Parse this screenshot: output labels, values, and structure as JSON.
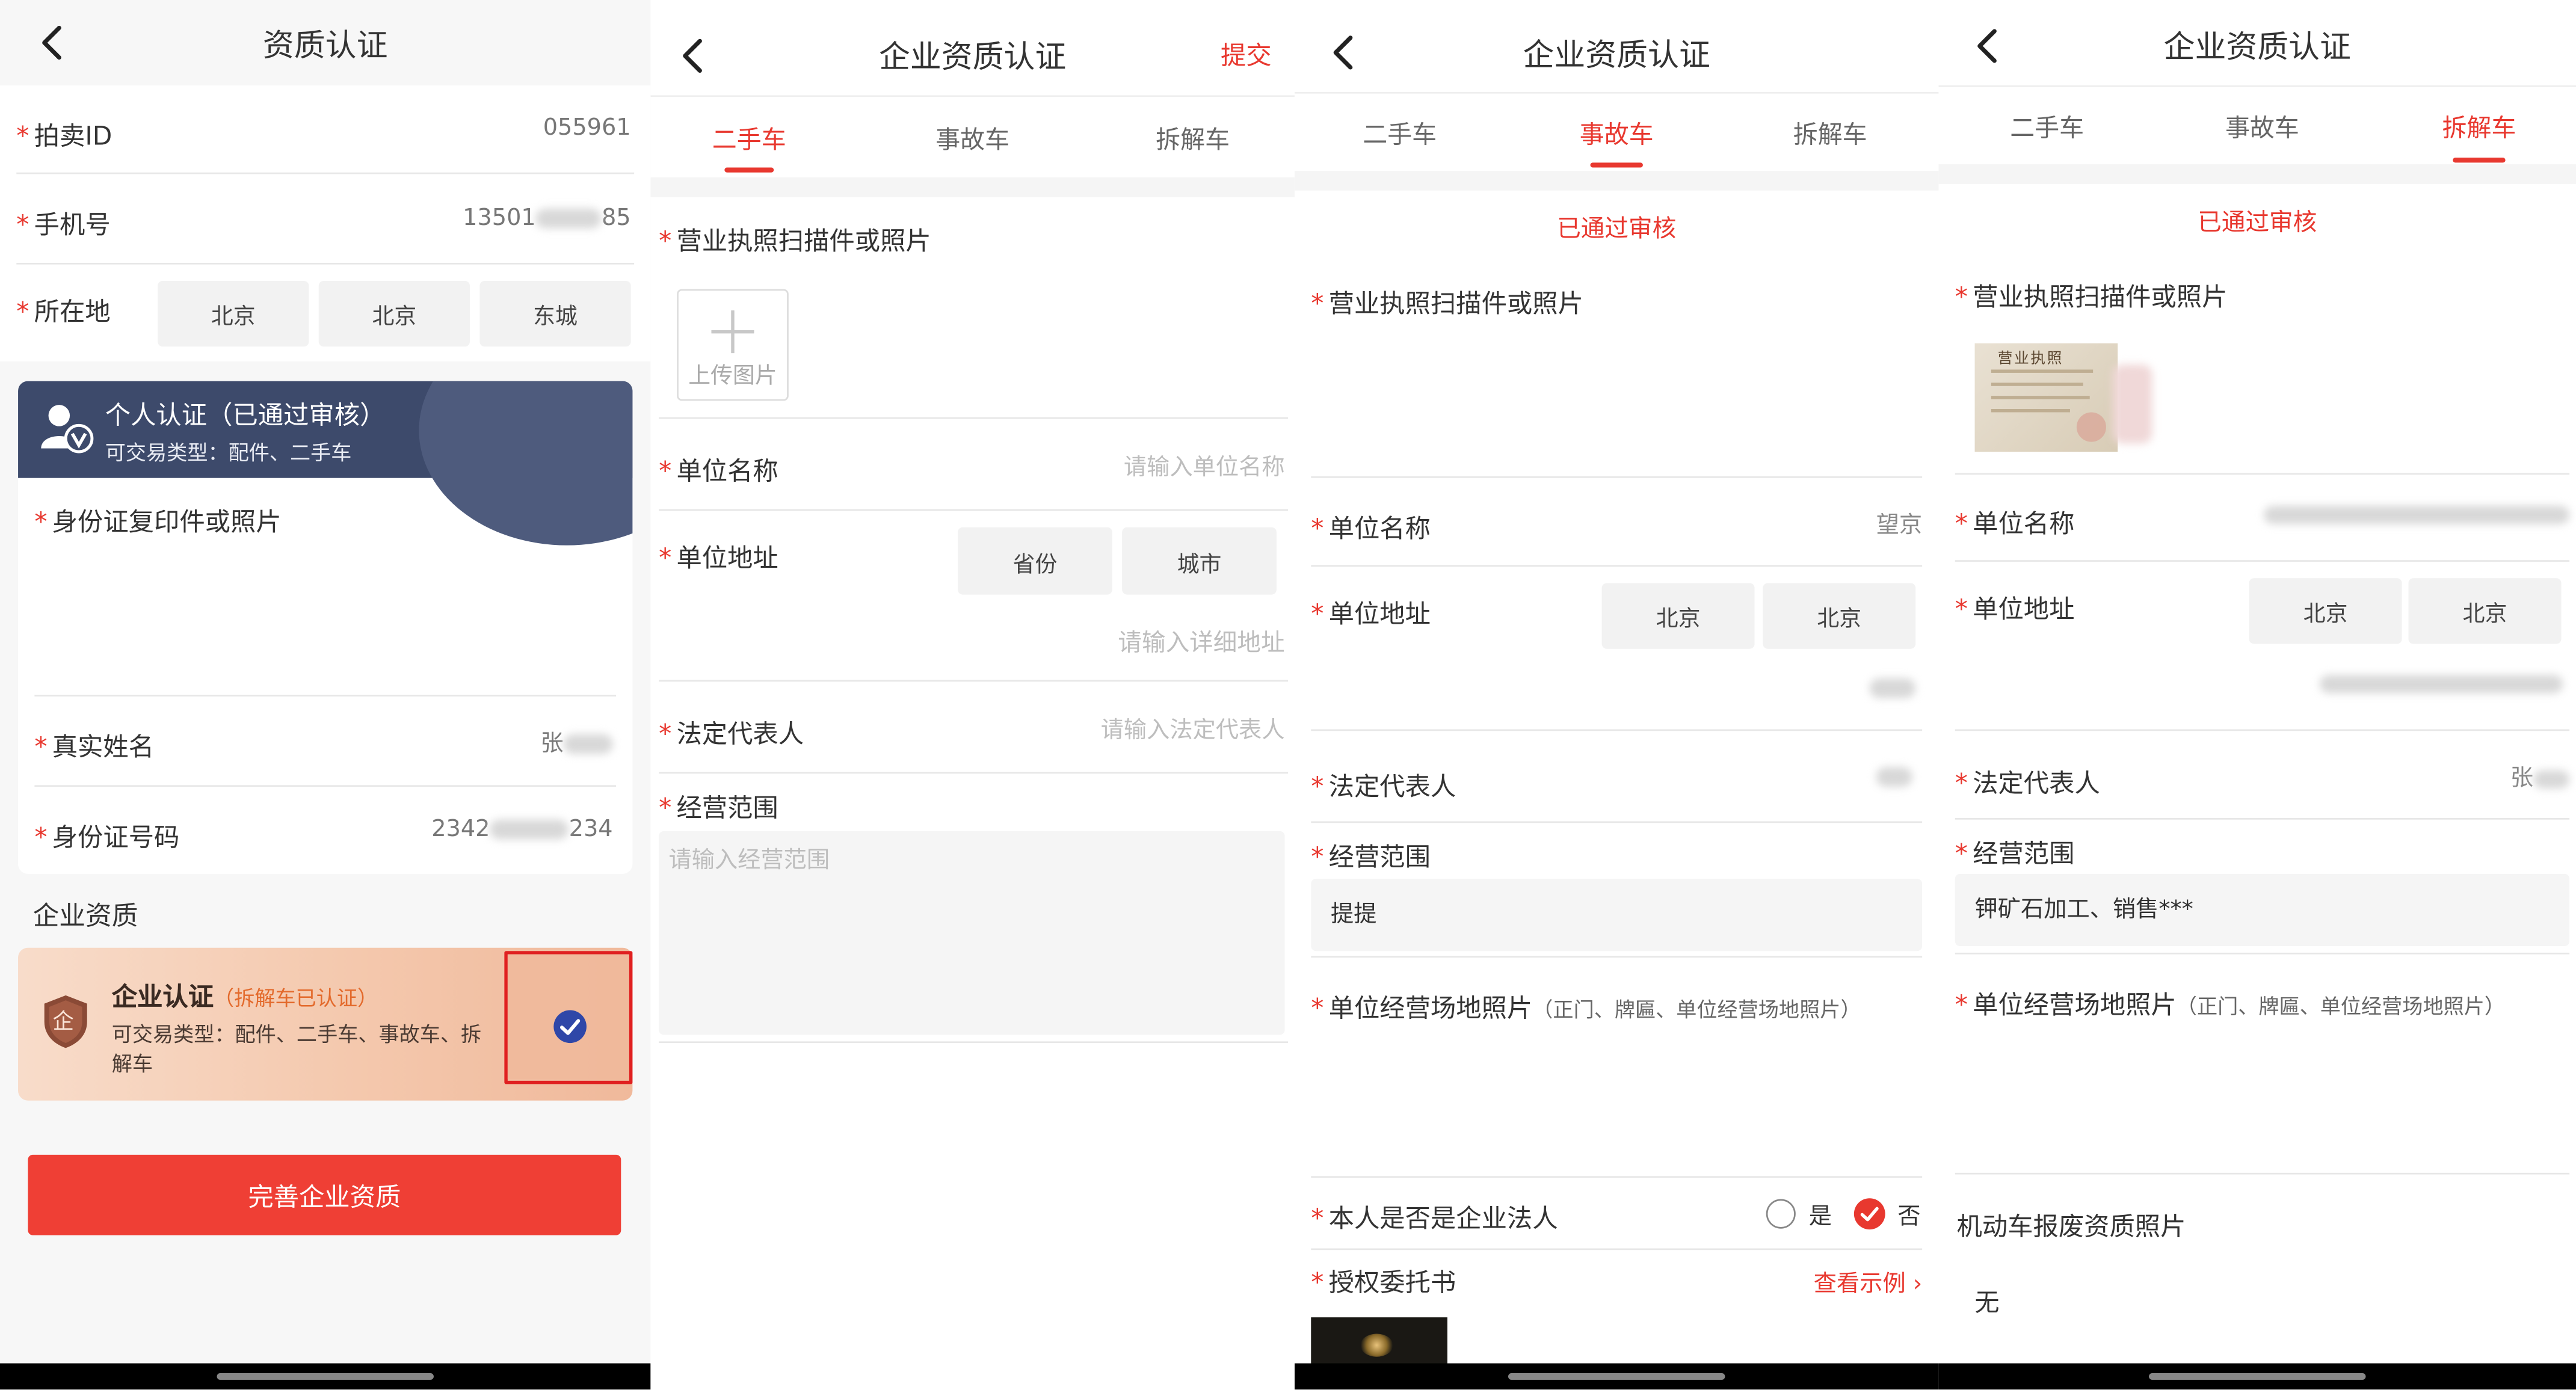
{
  "screen1": {
    "title": "资质认证",
    "required_star": "*",
    "auction_id_label": "拍卖ID",
    "auction_id_value": "055961",
    "phone_label": "手机号",
    "phone_value_prefix": "13501",
    "phone_value_suffix": "85",
    "location_label": "所在地",
    "location_boxes": [
      "北京",
      "北京",
      "东城"
    ],
    "personal_card": {
      "title": "个人认证（已通过审核）",
      "subtitle": "可交易类型：配件、二手车"
    },
    "id_photo_label": "身份证复印件或照片",
    "real_name_label": "真实姓名",
    "real_name_value": "张",
    "id_number_label": "身份证号码",
    "id_number_prefix": "2342",
    "id_number_suffix": "234",
    "enterprise_section": "企业资质",
    "enterprise_card": {
      "title": "企业认证",
      "status": "（拆解车已认证）",
      "types_line1": "可交易类型：配件、二手车、事故车、拆",
      "types_line2": "解车",
      "badge_char": "企"
    },
    "complete_button": "完善企业资质"
  },
  "screen2": {
    "title": "企业资质认证",
    "submit": "提交",
    "tabs": [
      "二手车",
      "事故车",
      "拆解车"
    ],
    "active_tab": 0,
    "license_label": "营业执照扫描件或照片",
    "upload_label": "上传图片",
    "unit_name_label": "单位名称",
    "unit_name_placeholder": "请输入单位名称",
    "unit_address_label": "单位地址",
    "province_box": "省份",
    "city_box": "城市",
    "detail_address_placeholder": "请输入详细地址",
    "legal_rep_label": "法定代表人",
    "legal_rep_placeholder": "请输入法定代表人",
    "scope_label": "经营范围",
    "scope_placeholder": "请输入经营范围"
  },
  "screen3": {
    "title": "企业资质认证",
    "tabs": [
      "二手车",
      "事故车",
      "拆解车"
    ],
    "active_tab": 1,
    "status": "已通过审核",
    "license_label": "营业执照扫描件或照片",
    "unit_name_label": "单位名称",
    "unit_name_value": "望京",
    "unit_address_label": "单位地址",
    "address_boxes": [
      "北京",
      "北京"
    ],
    "legal_rep_label": "法定代表人",
    "scope_label": "经营范围",
    "scope_value": "提提",
    "premises_label": "单位经营场地照片",
    "premises_hint": "（正门、牌匾、单位经营场地照片）",
    "is_legal_label": "本人是否是企业法人",
    "yes": "是",
    "no": "否",
    "selected_option": "no",
    "auth_letter_label": "授权委托书",
    "view_example": "查看示例",
    "chevron": "›"
  },
  "screen4": {
    "title": "企业资质认证",
    "tabs": [
      "二手车",
      "事故车",
      "拆解车"
    ],
    "active_tab": 2,
    "status": "已通过审核",
    "license_label": "营业执照扫描件或照片",
    "license_thumb_text": "营业执照",
    "unit_name_label": "单位名称",
    "unit_address_label": "单位地址",
    "address_boxes": [
      "北京",
      "北京"
    ],
    "legal_rep_label": "法定代表人",
    "legal_rep_value": "张",
    "scope_label": "经营范围",
    "scope_value": "钾矿石加工、销售***",
    "premises_label": "单位经营场地照片",
    "premises_hint": "（正门、牌匾、单位经营场地照片）",
    "scrap_photo_label": "机动车报废资质照片",
    "scrap_photo_value": "无"
  },
  "colors": {
    "accent_red": "#e8382f",
    "personal_card": "#3d4a6b",
    "enterprise_card": "#f6cdb3",
    "check_blue": "#2f47a8",
    "highlight_box": "#e02020"
  }
}
